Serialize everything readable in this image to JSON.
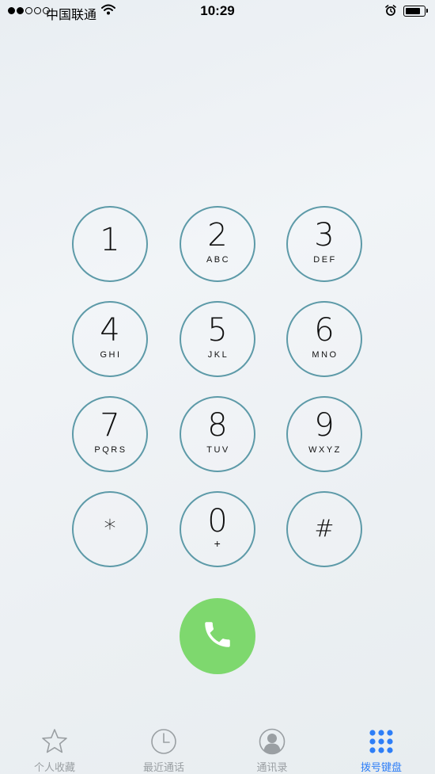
{
  "status_bar": {
    "carrier": "中国联通",
    "time": "10:29",
    "signal_strength": 2,
    "signal_max": 5,
    "battery_level": 0.8
  },
  "keypad": {
    "keys": [
      {
        "digit": "1",
        "letters": ""
      },
      {
        "digit": "2",
        "letters": "ABC"
      },
      {
        "digit": "3",
        "letters": "DEF"
      },
      {
        "digit": "4",
        "letters": "GHI"
      },
      {
        "digit": "5",
        "letters": "JKL"
      },
      {
        "digit": "6",
        "letters": "MNO"
      },
      {
        "digit": "7",
        "letters": "PQRS"
      },
      {
        "digit": "8",
        "letters": "TUV"
      },
      {
        "digit": "9",
        "letters": "WXYZ"
      },
      {
        "digit": "*",
        "letters": ""
      },
      {
        "digit": "0",
        "letters": "+"
      },
      {
        "digit": "#",
        "letters": ""
      }
    ]
  },
  "call_button": {
    "icon": "phone-handset-icon",
    "color": "#7ed86e"
  },
  "tab_bar": {
    "active_color": "#2d7ef7",
    "inactive_color": "#9a9fa3",
    "tabs": [
      {
        "label": "个人收藏",
        "icon": "star-icon",
        "active": false
      },
      {
        "label": "最近通话",
        "icon": "clock-icon",
        "active": false
      },
      {
        "label": "通讯录",
        "icon": "contacts-icon",
        "active": false
      },
      {
        "label": "拨号键盘",
        "icon": "keypad-icon",
        "active": true
      }
    ]
  }
}
